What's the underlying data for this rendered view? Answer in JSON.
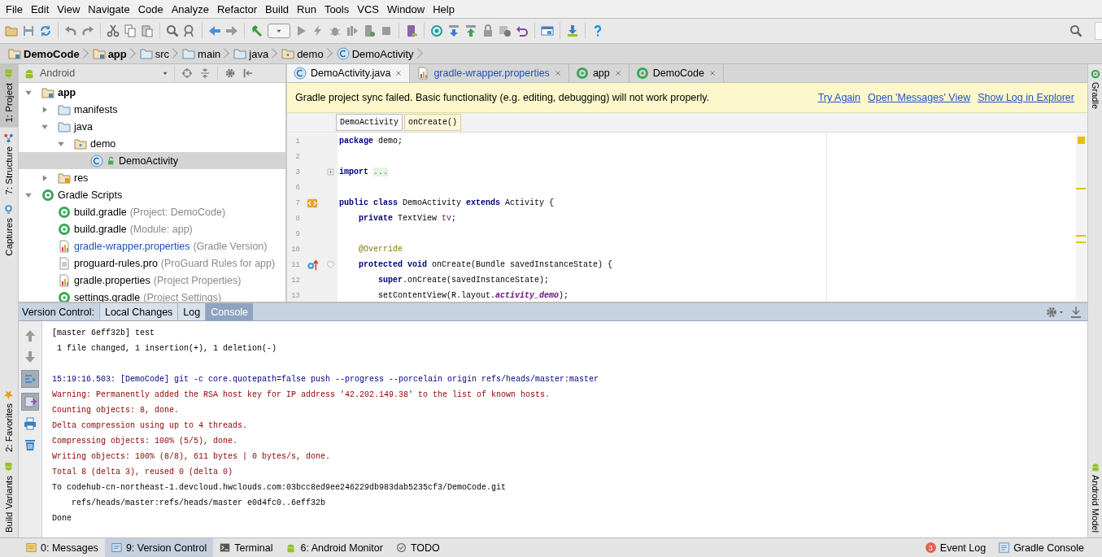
{
  "menu": [
    "File",
    "Edit",
    "View",
    "Navigate",
    "Code",
    "Analyze",
    "Refactor",
    "Build",
    "Run",
    "Tools",
    "VCS",
    "Window",
    "Help"
  ],
  "breadcrumbs": [
    {
      "label": "DemoCode",
      "kind": "project"
    },
    {
      "label": "app",
      "kind": "module"
    },
    {
      "label": "src",
      "kind": "folder"
    },
    {
      "label": "main",
      "kind": "folder"
    },
    {
      "label": "java",
      "kind": "source"
    },
    {
      "label": "demo",
      "kind": "package"
    },
    {
      "label": "DemoActivity",
      "kind": "class"
    }
  ],
  "left_strip": {
    "top": [
      {
        "label": "1: Project",
        "kind": "project",
        "selected": true
      },
      {
        "label": "7: Structure",
        "kind": "structure",
        "selected": false
      },
      {
        "label": "Captures",
        "kind": "captures",
        "selected": false
      }
    ],
    "bottom": [
      {
        "label": "2: Favorites",
        "kind": "favorites",
        "selected": false
      },
      {
        "label": "Build Variants",
        "kind": "android",
        "selected": false
      }
    ]
  },
  "right_strip": {
    "top": [
      {
        "label": "Gradle",
        "kind": "gradle"
      }
    ],
    "bottom": [
      {
        "label": "Android Model",
        "kind": "android"
      }
    ]
  },
  "project_panel": {
    "view": "Android",
    "tree": [
      {
        "label": "app",
        "kind": "module",
        "expanded": true,
        "selected": false,
        "modified": false,
        "children": [
          {
            "label": "manifests",
            "kind": "folder",
            "expanded": false,
            "selected": false,
            "modified": false
          },
          {
            "label": "java",
            "kind": "folder",
            "expanded": true,
            "selected": false,
            "modified": false,
            "children": [
              {
                "label": "demo",
                "kind": "package",
                "expanded": true,
                "selected": false,
                "modified": false,
                "children": [
                  {
                    "label": "DemoActivity",
                    "kind": "class",
                    "selected": true,
                    "modified": false
                  }
                ]
              }
            ]
          },
          {
            "label": "res",
            "kind": "res",
            "expanded": false,
            "selected": false,
            "modified": false
          }
        ]
      },
      {
        "label": "Gradle Scripts",
        "kind": "gradle",
        "expanded": true,
        "selected": false,
        "modified": false,
        "children": [
          {
            "label": "build.gradle",
            "hint": "(Project: DemoCode)",
            "kind": "gradle",
            "selected": false,
            "modified": false
          },
          {
            "label": "build.gradle",
            "hint": "(Module: app)",
            "kind": "gradle",
            "selected": false,
            "modified": false
          },
          {
            "label": "gradle-wrapper.properties",
            "hint": "(Gradle Version)",
            "kind": "properties",
            "selected": false,
            "modified": true
          },
          {
            "label": "proguard-rules.pro",
            "hint": "(ProGuard Rules for app)",
            "kind": "text",
            "selected": false,
            "modified": false
          },
          {
            "label": "gradle.properties",
            "hint": "(Project Properties)",
            "kind": "properties",
            "selected": false,
            "modified": false
          },
          {
            "label": "settings.gradle",
            "hint": "(Project Settings)",
            "kind": "gradle",
            "selected": false,
            "modified": false
          }
        ]
      }
    ]
  },
  "editor": {
    "tabs": [
      {
        "label": "DemoActivity.java",
        "kind": "class",
        "selected": true,
        "modified": false
      },
      {
        "label": "gradle-wrapper.properties",
        "kind": "properties",
        "selected": false,
        "modified": true
      },
      {
        "label": "app",
        "kind": "gradle",
        "selected": false,
        "modified": false
      },
      {
        "label": "DemoCode",
        "kind": "gradle",
        "selected": false,
        "modified": false
      }
    ],
    "notification": {
      "message": "Gradle project sync failed. Basic functionality (e.g. editing, debugging) will not work properly.",
      "links": [
        "Try Again",
        "Open 'Messages' View",
        "Show Log in Explorer"
      ]
    },
    "crumbs": [
      {
        "label": "DemoActivity",
        "selected": false
      },
      {
        "label": "onCreate()",
        "selected": true
      }
    ],
    "lines": [
      {
        "number": "1",
        "tokens": [
          {
            "text": "package",
            "kind": "keyword"
          },
          {
            "text": " demo;",
            "kind": "plain"
          }
        ]
      },
      {
        "number": "2"
      },
      {
        "number": "3",
        "fold": {
          "kind": "expand"
        },
        "tokens": [
          {
            "text": "import ",
            "kind": "keyword"
          },
          {
            "text": "...",
            "kind": "folded"
          }
        ]
      },
      {
        "number": "6"
      },
      {
        "number": "7",
        "marker": {
          "kind": "layout"
        },
        "tokens": [
          {
            "text": "public class",
            "kind": "keyword"
          },
          {
            "text": " DemoActivity ",
            "kind": "plain"
          },
          {
            "text": "extends",
            "kind": "keyword"
          },
          {
            "text": " Activity {",
            "kind": "plain"
          }
        ]
      },
      {
        "number": "8",
        "tokens": [
          {
            "text": "    private",
            "kind": "keyword"
          },
          {
            "text": " TextView ",
            "kind": "plain"
          },
          {
            "text": "tv",
            "kind": "field"
          },
          {
            "text": ";",
            "kind": "plain"
          }
        ]
      },
      {
        "number": "9"
      },
      {
        "number": "10",
        "tokens": [
          {
            "text": "    @Override",
            "kind": "annotation"
          }
        ]
      },
      {
        "number": "11",
        "marker": {
          "kind": "override"
        },
        "fold": {
          "kind": "collapse"
        },
        "tokens": [
          {
            "text": "    protected void",
            "kind": "keyword"
          },
          {
            "text": " onCreate(Bundle savedInstanceState) {",
            "kind": "plain"
          }
        ]
      },
      {
        "number": "12",
        "tokens": [
          {
            "text": "        super",
            "kind": "keyword"
          },
          {
            "text": ".onCreate(savedInstanceState);",
            "kind": "plain"
          }
        ]
      },
      {
        "number": "13",
        "tokens": [
          {
            "text": "        setContentView(R.layout.",
            "kind": "plain"
          },
          {
            "text": "activity_demo",
            "kind": "static"
          },
          {
            "text": ");",
            "kind": "plain"
          }
        ]
      }
    ]
  },
  "tool_window": {
    "title": "Version Control:",
    "tabs": [
      {
        "label": "Local Changes",
        "selected": false
      },
      {
        "label": "Log",
        "selected": false
      },
      {
        "label": "Console",
        "selected": true
      }
    ],
    "console": [
      {
        "text": "[master 6eff32b] test",
        "kind": "output"
      },
      {
        "text": " 1 file changed, 1 insertion(+), 1 deletion(-)",
        "kind": "output"
      },
      {
        "kind": "blank"
      },
      {
        "text": "15:19:16.503: [DemoCode] git -c core.quotepath=false push --progress --porcelain origin refs/heads/master:master",
        "kind": "command"
      },
      {
        "text": "Warning: Permanently added the RSA host key for IP address '42.202.149.38' to the list of known hosts.",
        "kind": "error"
      },
      {
        "text": "Counting objects: 8, done.",
        "kind": "error"
      },
      {
        "text": "Delta compression using up to 4 threads.",
        "kind": "error"
      },
      {
        "text": "Compressing objects: 100% (5/5), done.",
        "kind": "error"
      },
      {
        "text": "Writing objects: 100% (8/8), 611 bytes | 0 bytes/s, done.",
        "kind": "error"
      },
      {
        "text": "Total 8 (delta 3), reused 0 (delta 0)",
        "kind": "error"
      },
      {
        "text": "To codehub-cn-northeast-1.devcloud.hwclouds.com:03bcc8ed9ee246229db983dab5235cf3/DemoCode.git",
        "kind": "output"
      },
      {
        "text": "    refs/heads/master:refs/heads/master e0d4fc0..6eff32b",
        "kind": "output"
      },
      {
        "text": "Done",
        "kind": "output"
      }
    ]
  },
  "status_bar": {
    "left": [
      {
        "label": "0: Messages",
        "kind": "messages",
        "selected": false
      },
      {
        "label": "9: Version Control",
        "kind": "vcs",
        "selected": true
      },
      {
        "label": "Terminal",
        "kind": "terminal",
        "selected": false
      },
      {
        "label": "6: Android Monitor",
        "kind": "android",
        "selected": false
      },
      {
        "label": "TODO",
        "kind": "todo",
        "selected": false
      }
    ],
    "right": [
      {
        "label": "Event Log",
        "kind": "event",
        "badge": "3"
      },
      {
        "label": "Gradle Console",
        "kind": "console"
      }
    ]
  }
}
